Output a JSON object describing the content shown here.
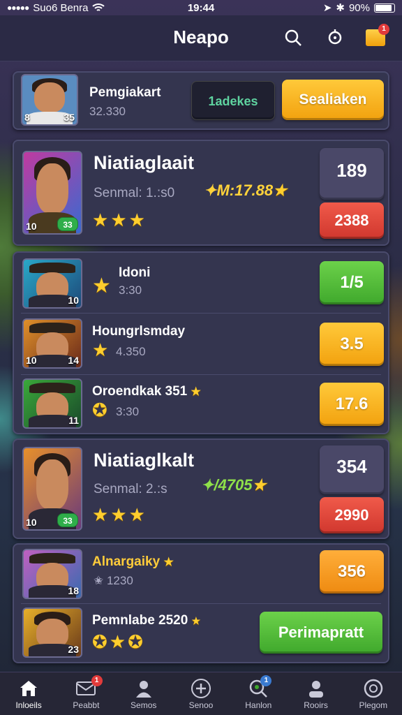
{
  "status": {
    "carrier": "Suo6 Benra",
    "time": "19:44",
    "battery": "90%"
  },
  "header": {
    "title": "Neapo",
    "notifications": "1"
  },
  "top": {
    "name": "Pemgiakart",
    "score": "32.330",
    "level": "8",
    "level2": "35",
    "dark_button": "1adekes",
    "action_button": "Sealiaken"
  },
  "card1": {
    "name": "Niatiaglaait",
    "sub": "Senmal: 1.:s0",
    "score": "M:17.88",
    "level": "10",
    "gem": "33",
    "stat": "189",
    "action": "2388"
  },
  "list1": [
    {
      "name": "Idoni",
      "sub": "3:30",
      "level": "10",
      "button": "1/5"
    },
    {
      "name": "Houngrlsmday",
      "sub": "4.350",
      "level": "10",
      "level2": "14",
      "button": "3.5"
    },
    {
      "name": "Oroendkak 351",
      "sub": "3:30",
      "level": "11",
      "button": "17.6"
    }
  ],
  "card2": {
    "name": "Niatiaglkalt",
    "sub": "Senmal: 2.:s",
    "score": "/4705",
    "level": "10",
    "gem": "33",
    "stat": "354",
    "action": "2990"
  },
  "list2": [
    {
      "name": "Alnargaiky",
      "sub": "1230",
      "level": "18",
      "button": "356"
    },
    {
      "name": "Pemnlabe 2520",
      "level": "23",
      "button": "Perimapratt"
    }
  ],
  "tabs": [
    {
      "label": "Inloeils",
      "icon": "home-icon"
    },
    {
      "label": "Peabbt",
      "icon": "mail-icon",
      "badge": "1"
    },
    {
      "label": "Semos",
      "icon": "person-icon"
    },
    {
      "label": "Senoo",
      "icon": "plus-icon"
    },
    {
      "label": "Hanlon",
      "icon": "search-icon",
      "badge": "1"
    },
    {
      "label": "Rooirs",
      "icon": "profile-icon"
    },
    {
      "label": "Plegom",
      "icon": "target-icon"
    }
  ]
}
